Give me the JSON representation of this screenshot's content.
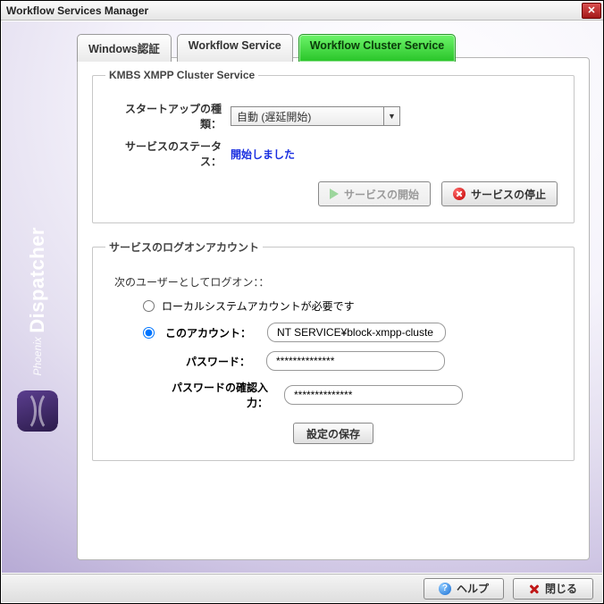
{
  "window": {
    "title": "Workflow Services Manager"
  },
  "brand": {
    "main": "Dispatcher",
    "sub": "Phoenix"
  },
  "tabs": {
    "auth": "Windows認証",
    "service": "Workflow Service",
    "cluster": "Workflow Cluster Service"
  },
  "cluster_group": {
    "legend": "KMBS XMPP Cluster Service",
    "startup_label": "スタートアップの種類：",
    "startup_value": "自動 (遅延開始)",
    "status_label": "サービスのステータス：",
    "status_value": "開始しました",
    "start_btn": "サービスの開始",
    "stop_btn": "サービスの停止"
  },
  "logon_group": {
    "legend": "サービスのログオンアカウント",
    "logon_as": "次のユーザーとしてログオン：：",
    "local_system": "ローカルシステムアカウントが必要です",
    "this_account": "このアカウント：",
    "account_value": "NT SERVICE¥block-xmpp-cluste",
    "password_label": "パスワード：",
    "password_value": "**************",
    "confirm_label": "パスワードの確認入力：",
    "confirm_value": "**************",
    "save_btn": "設定の保存"
  },
  "footer": {
    "help": "ヘルプ",
    "close": "閉じる"
  }
}
